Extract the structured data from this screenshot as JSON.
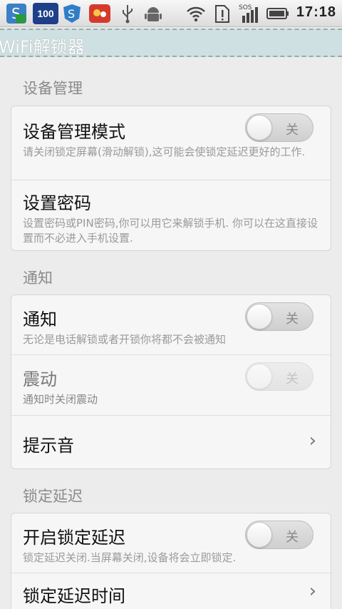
{
  "status_bar": {
    "battery_badge": "100",
    "time": "17:18",
    "icons": [
      "app-icon-s",
      "battery-100-icon",
      "shield-s-icon",
      "game-icon",
      "usb-icon",
      "android-icon",
      "wifi-icon",
      "alert-icon",
      "signal-sos-icon",
      "battery-icon"
    ]
  },
  "title_bar": {
    "title": "WiFi解锁器"
  },
  "sections": {
    "device": {
      "title": "设备管理",
      "admin_mode": {
        "title": "设备管理模式",
        "desc": "请关闭锁定屏幕(滑动解锁),这可能会使锁定延迟更好的工作.",
        "toggle": "关"
      },
      "set_password": {
        "title": "设置密码",
        "desc": "设置密码或PIN密码,你可以用它来解锁手机. 你可以在这直接设置而不必进入手机设置."
      }
    },
    "notify": {
      "title": "通知",
      "notify": {
        "title": "通知",
        "desc": "无论是电话解锁或者开锁你将都不会被通知",
        "toggle": "关"
      },
      "vibrate": {
        "title": "震动",
        "desc": "通知时关闭震动",
        "toggle": "关"
      },
      "sound": {
        "title": "提示音",
        "chevron": "›"
      }
    },
    "lock_delay": {
      "title": "锁定延迟",
      "enable": {
        "title": "开启锁定延迟",
        "desc": "锁定延迟关闭.当屏幕关闭,设备将会立即锁定.",
        "toggle": "关"
      },
      "delay_time": {
        "title": "锁定延迟时间",
        "chevron": "›"
      }
    }
  },
  "colors": {
    "title_bar_bg": "#cfe0e3",
    "background": "#ececec",
    "card_bg": "#f6f6f6"
  }
}
